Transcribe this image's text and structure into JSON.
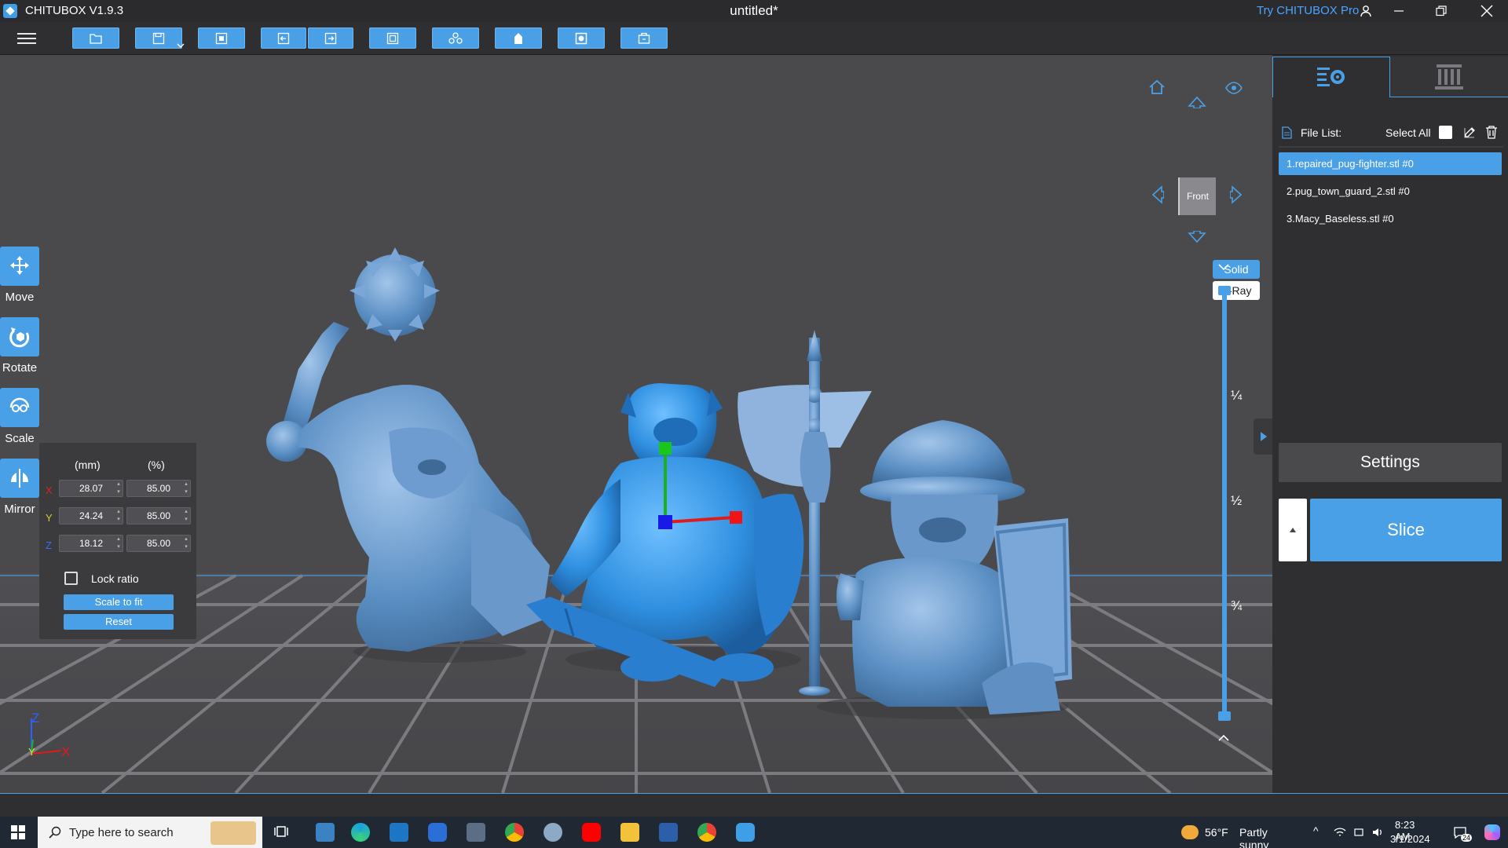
{
  "window": {
    "app_title": "CHITUBOX V1.9.3",
    "doc_title": "untitled*",
    "try_pro": "Try CHITUBOX Pro"
  },
  "tools": {
    "move": "Move",
    "rotate": "Rotate",
    "scale": "Scale",
    "mirror": "Mirror"
  },
  "scale_panel": {
    "col_mm": "(mm)",
    "col_pct": "(%)",
    "x": {
      "label": "X",
      "mm": "28.07",
      "pct": "85.00"
    },
    "y": {
      "label": "Y",
      "mm": "24.24",
      "pct": "85.00"
    },
    "z": {
      "label": "Z",
      "mm": "18.12",
      "pct": "85.00"
    },
    "lock_ratio": "Lock ratio",
    "scale_to_fit": "Scale to fit",
    "reset": "Reset"
  },
  "view": {
    "front": "Front",
    "solid": "Solid",
    "xray": "X-Ray",
    "frac_quarter": "¼",
    "frac_half": "½",
    "frac_three_quarter": "¾"
  },
  "axes": {
    "z": "Z",
    "y": "Y",
    "x": "X"
  },
  "file_list": {
    "title": "File List:",
    "select_all": "Select All",
    "items": [
      "1.repaired_pug-fighter.stl #0",
      "2.pug_town_guard_2.stl #0",
      "3.Macy_Baseless.stl #0"
    ]
  },
  "actions": {
    "settings": "Settings",
    "slice": "Slice"
  },
  "taskbar": {
    "search_placeholder": "Type here to search",
    "temperature": "56°F",
    "weather": "Partly sunny",
    "time": "8:23 AM",
    "date": "3/1/2024",
    "notification_count": "24"
  },
  "colors": {
    "accent": "#4aa0e6",
    "model_selected": "#2f8fe0",
    "model_unselected": "#5b8fc4",
    "grid_line": "#8a8a8e"
  }
}
